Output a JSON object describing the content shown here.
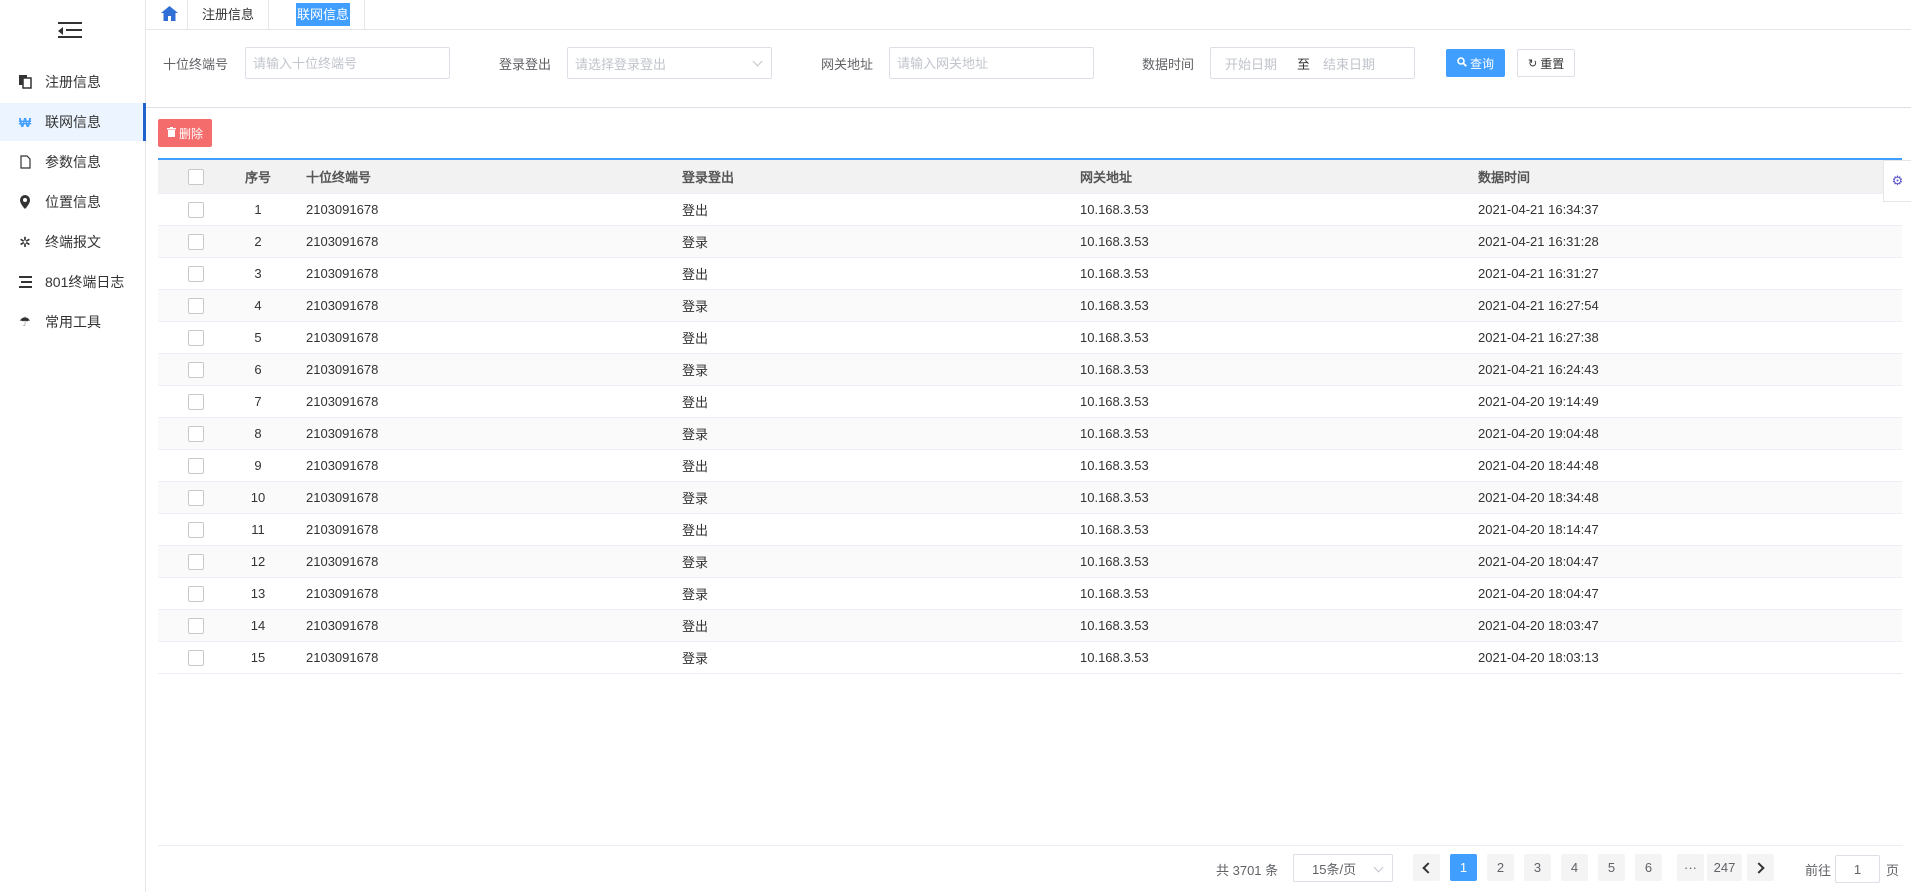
{
  "sidebar": {
    "items": [
      {
        "label": "注册信息",
        "icon": "copy-icon"
      },
      {
        "label": "联网信息",
        "icon": "won-icon"
      },
      {
        "label": "参数信息",
        "icon": "file-icon"
      },
      {
        "label": "位置信息",
        "icon": "map-pin-icon"
      },
      {
        "label": "终端报文",
        "icon": "cogs-icon"
      },
      {
        "label": "801终端日志",
        "icon": "list-icon"
      },
      {
        "label": "常用工具",
        "icon": "umbrella-icon"
      }
    ],
    "active_index": 1
  },
  "tabs": [
    {
      "label": "注册信息"
    },
    {
      "label": "联网信息"
    }
  ],
  "filters": {
    "term_label": "十位终端号",
    "term_placeholder": "请输入十位终端号",
    "login_label": "登录登出",
    "login_placeholder": "请选择登录登出",
    "gw_label": "网关地址",
    "gw_placeholder": "请输入网关地址",
    "time_label": "数据时间",
    "start_placeholder": "开始日期",
    "range_sep": "至",
    "end_placeholder": "结束日期",
    "query_label": "查询",
    "reset_label": "重置"
  },
  "toolbar": {
    "delete_label": "删除"
  },
  "table": {
    "headers": {
      "idx": "序号",
      "term": "十位终端号",
      "login": "登录登出",
      "gw": "网关地址",
      "time": "数据时间"
    },
    "rows": [
      {
        "idx": "1",
        "term": "2103091678",
        "login": "登出",
        "gw": "10.168.3.53",
        "time": "2021-04-21 16:34:37"
      },
      {
        "idx": "2",
        "term": "2103091678",
        "login": "登录",
        "gw": "10.168.3.53",
        "time": "2021-04-21 16:31:28"
      },
      {
        "idx": "3",
        "term": "2103091678",
        "login": "登出",
        "gw": "10.168.3.53",
        "time": "2021-04-21 16:31:27"
      },
      {
        "idx": "4",
        "term": "2103091678",
        "login": "登录",
        "gw": "10.168.3.53",
        "time": "2021-04-21 16:27:54"
      },
      {
        "idx": "5",
        "term": "2103091678",
        "login": "登出",
        "gw": "10.168.3.53",
        "time": "2021-04-21 16:27:38"
      },
      {
        "idx": "6",
        "term": "2103091678",
        "login": "登录",
        "gw": "10.168.3.53",
        "time": "2021-04-21 16:24:43"
      },
      {
        "idx": "7",
        "term": "2103091678",
        "login": "登出",
        "gw": "10.168.3.53",
        "time": "2021-04-20 19:14:49"
      },
      {
        "idx": "8",
        "term": "2103091678",
        "login": "登录",
        "gw": "10.168.3.53",
        "time": "2021-04-20 19:04:48"
      },
      {
        "idx": "9",
        "term": "2103091678",
        "login": "登出",
        "gw": "10.168.3.53",
        "time": "2021-04-20 18:44:48"
      },
      {
        "idx": "10",
        "term": "2103091678",
        "login": "登录",
        "gw": "10.168.3.53",
        "time": "2021-04-20 18:34:48"
      },
      {
        "idx": "11",
        "term": "2103091678",
        "login": "登出",
        "gw": "10.168.3.53",
        "time": "2021-04-20 18:14:47"
      },
      {
        "idx": "12",
        "term": "2103091678",
        "login": "登录",
        "gw": "10.168.3.53",
        "time": "2021-04-20 18:04:47"
      },
      {
        "idx": "13",
        "term": "2103091678",
        "login": "登录",
        "gw": "10.168.3.53",
        "time": "2021-04-20 18:04:47"
      },
      {
        "idx": "14",
        "term": "2103091678",
        "login": "登出",
        "gw": "10.168.3.53",
        "time": "2021-04-20 18:03:47"
      },
      {
        "idx": "15",
        "term": "2103091678",
        "login": "登录",
        "gw": "10.168.3.53",
        "time": "2021-04-20 18:03:13"
      }
    ]
  },
  "pagination": {
    "total_text": "共 3701 条",
    "page_size": "15条/页",
    "pages": [
      "1",
      "2",
      "3",
      "4",
      "5",
      "6"
    ],
    "ellipsis": "···",
    "last_page": "247",
    "current": "1",
    "goto_label": "前往",
    "goto_value": "1",
    "page_suffix": "页"
  },
  "colors": {
    "primary": "#409eff",
    "danger": "#f56c6c",
    "active_border": "#1f62c9"
  }
}
